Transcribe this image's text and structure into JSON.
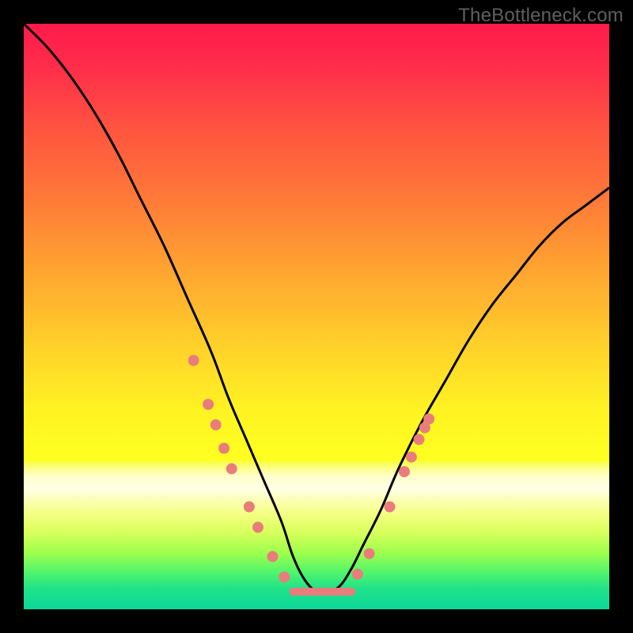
{
  "watermark": "TheBottleneck.com",
  "colors": {
    "black": "#000000",
    "curve": "#000000",
    "dot": "#e97d7c",
    "gradient_stops": [
      {
        "y": 0.0,
        "c": "#ff1a4b"
      },
      {
        "y": 0.08,
        "c": "#ff2f4a"
      },
      {
        "y": 0.18,
        "c": "#ff5440"
      },
      {
        "y": 0.3,
        "c": "#ff7a38"
      },
      {
        "y": 0.42,
        "c": "#ffa431"
      },
      {
        "y": 0.55,
        "c": "#ffd12a"
      },
      {
        "y": 0.66,
        "c": "#fff323"
      },
      {
        "y": 0.745,
        "c": "#ffff20"
      },
      {
        "y": 0.752,
        "c": "#f8ff62"
      },
      {
        "y": 0.772,
        "c": "#ffffca"
      },
      {
        "y": 0.795,
        "c": "#ffffe6"
      },
      {
        "y": 0.815,
        "c": "#fbffb0"
      },
      {
        "y": 0.84,
        "c": "#f3ff7e"
      },
      {
        "y": 0.87,
        "c": "#d6ff5a"
      },
      {
        "y": 0.905,
        "c": "#9bff4e"
      },
      {
        "y": 0.935,
        "c": "#55f56a"
      },
      {
        "y": 0.965,
        "c": "#1fe289"
      },
      {
        "y": 1.0,
        "c": "#0bd79a"
      }
    ]
  },
  "chart_data": {
    "type": "line",
    "title": "",
    "xlabel": "",
    "ylabel": "",
    "xlim": [
      0,
      100
    ],
    "ylim": [
      0,
      100
    ],
    "note": "x is normalized position across the plot; y is bottleneck percentage (0 = no bottleneck at bottom, 100 = severe at top). Values estimated from pixel positions.",
    "series": [
      {
        "name": "bottleneck-curve",
        "x": [
          0,
          4,
          8,
          12,
          16,
          20,
          24,
          28,
          32,
          35,
          38,
          41,
          44,
          46,
          48,
          50,
          52,
          54,
          56,
          58,
          61,
          64,
          68,
          72,
          76,
          80,
          84,
          88,
          92,
          96,
          100
        ],
        "y": [
          100,
          96,
          91,
          85,
          78,
          70,
          62,
          53,
          44,
          36,
          29,
          22,
          15,
          9,
          5,
          3,
          3,
          4,
          7,
          11,
          17,
          24,
          32,
          39,
          46,
          52,
          57,
          62,
          66,
          69,
          72
        ]
      }
    ],
    "flat_segment": {
      "x0": 46,
      "x1": 56,
      "y": 3
    },
    "markers": [
      {
        "x": 29.0,
        "y": 42.5
      },
      {
        "x": 31.5,
        "y": 35.0
      },
      {
        "x": 32.8,
        "y": 31.5
      },
      {
        "x": 34.2,
        "y": 27.5
      },
      {
        "x": 35.5,
        "y": 24.0
      },
      {
        "x": 38.5,
        "y": 17.5
      },
      {
        "x": 40.0,
        "y": 14.0
      },
      {
        "x": 42.5,
        "y": 9.0
      },
      {
        "x": 44.5,
        "y": 5.5
      },
      {
        "x": 57.0,
        "y": 6.0
      },
      {
        "x": 59.0,
        "y": 9.5
      },
      {
        "x": 62.5,
        "y": 17.5
      },
      {
        "x": 65.0,
        "y": 23.5
      },
      {
        "x": 66.2,
        "y": 26.0
      },
      {
        "x": 67.5,
        "y": 29.0
      },
      {
        "x": 68.5,
        "y": 31.0
      },
      {
        "x": 69.2,
        "y": 32.5
      }
    ]
  }
}
